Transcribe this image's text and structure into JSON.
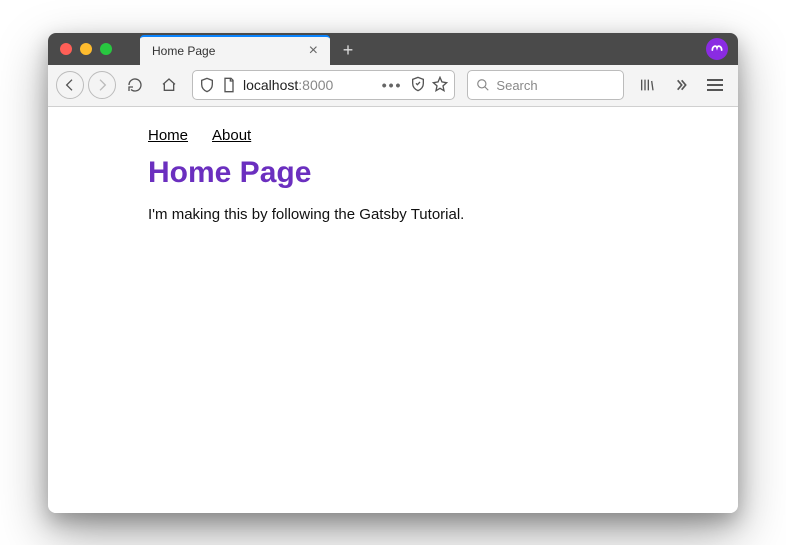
{
  "tab": {
    "title": "Home Page"
  },
  "url": {
    "host": "localhost",
    "port": ":8000"
  },
  "search": {
    "placeholder": "Search"
  },
  "nav": {
    "home": "Home",
    "about": "About"
  },
  "page": {
    "heading": "Home Page",
    "body": "I'm making this by following the Gatsby Tutorial."
  }
}
